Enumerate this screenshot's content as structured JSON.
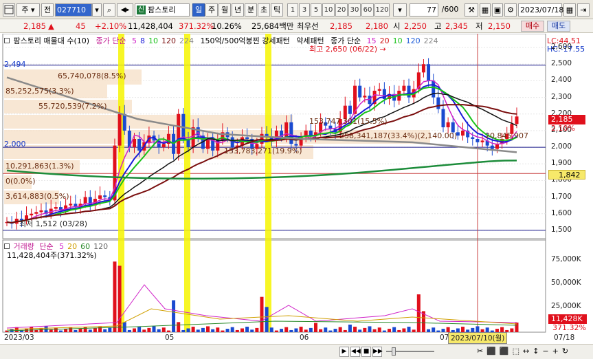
{
  "toolbar": {
    "type_label": "주",
    "market_label": "전",
    "code": "027710",
    "stock_tag": "신",
    "stock_name": "팜스토리",
    "periods": [
      "일",
      "주",
      "월",
      "년",
      "분",
      "초",
      "틱"
    ],
    "minutes": [
      "1",
      "3",
      "5",
      "10",
      "20",
      "30",
      "60",
      "120"
    ],
    "count": "77",
    "count_total": "/600",
    "date": "2023/07/18"
  },
  "quote": {
    "price": "2,185",
    "arrow": "▲",
    "change": "45",
    "change_pct": "+2.10%",
    "volume": "11,428,404",
    "volume_ratio": "371.32%",
    "turnover": "10.26%",
    "amount": "25,684백만",
    "best_ask_label": "최우선",
    "best_ask": "2,185",
    "best_bid": "2,180",
    "open_label": "시",
    "open": "2,250",
    "high_label": "고",
    "high": "2,345",
    "low_label": "저",
    "low": "2,150",
    "buy_label": "매수",
    "sell_label": "매도"
  },
  "legend": {
    "title": "팜스토리 매물대 수(10)",
    "ma_label": "종가 단순",
    "ma_periods": [
      "5",
      "8",
      "10",
      "120",
      "224"
    ],
    "ma_colors": [
      "#d022c8",
      "#1a1ad8",
      "#18c018",
      "#7a0e0e",
      "#8a8a8a"
    ],
    "pattern_text": "150억/500억봉찐 강세패턴",
    "weak_pattern": "약세패턴",
    "ma2_label": "종가 단순",
    "ma2_periods": [
      "15",
      "20",
      "10",
      "120",
      "224"
    ],
    "ma2_colors": [
      "#d022c8",
      "#d01010",
      "#18c018",
      "#1a5ad8",
      "#8a8a8a"
    ],
    "lc": "LC:44.51",
    "hc": "HC:-17.55"
  },
  "annotations": {
    "high_text": "최고 2,650 (06/22) →",
    "low_text": "최저 1,512 (03/28)",
    "vp": [
      "65,740,078(8.5%)",
      "85,252,575(3.3%)",
      "55,720,539(7.2%)",
      "153,747,301(15.5%)",
      "258,341,187(33.4%)(2,140.00)",
      "153,783,271(19.9%)",
      "10,291,863(1.3%)",
      "0(0.0%)",
      "3,614,883(0.5%)",
      "20,845,907"
    ],
    "line_2494": "2,494",
    "line_2000": "2,000"
  },
  "price_axis": {
    "ticks": [
      "2,600",
      "2,500",
      "2,400",
      "2,300",
      "2,200",
      "2,100",
      "2,000",
      "1,900",
      "1,800",
      "1,700",
      "1,600",
      "1,500"
    ],
    "current_price": "2,185",
    "current_pct": "2.10%",
    "ref_price": "1,842"
  },
  "volume_panel": {
    "title": "거래량",
    "ma_label": "단순",
    "ma_periods": [
      "5",
      "20",
      "60",
      "120"
    ],
    "ma_colors": [
      "#d022c8",
      "#d0a000",
      "#2a8a2a",
      "#666666"
    ],
    "value_text": "11,428,404주(371.32%)",
    "ticks": [
      "75,000K",
      "50,000K",
      "25,000K"
    ],
    "current": "11,428K",
    "current_pct": "371.32%"
  },
  "dates": {
    "labels": [
      "2023/03",
      "05",
      "06",
      "07"
    ],
    "cursor_date": "2023/07/10(월)",
    "end_label": "07/18"
  },
  "chart_data": {
    "type": "candlestick",
    "title": "팜스토리",
    "ylim": [
      1450,
      2650
    ],
    "current_price": 2185,
    "reference_lines": [
      2494,
      2000,
      1842
    ],
    "moving_averages": [
      "5",
      "8",
      "10",
      "120",
      "224"
    ],
    "period_high": {
      "value": 2650,
      "date": "06/22"
    },
    "period_low": {
      "value": 1512,
      "date": "03/28"
    },
    "volume_ticks_k": [
      25000,
      50000,
      75000
    ],
    "last_volume": 11428404
  }
}
